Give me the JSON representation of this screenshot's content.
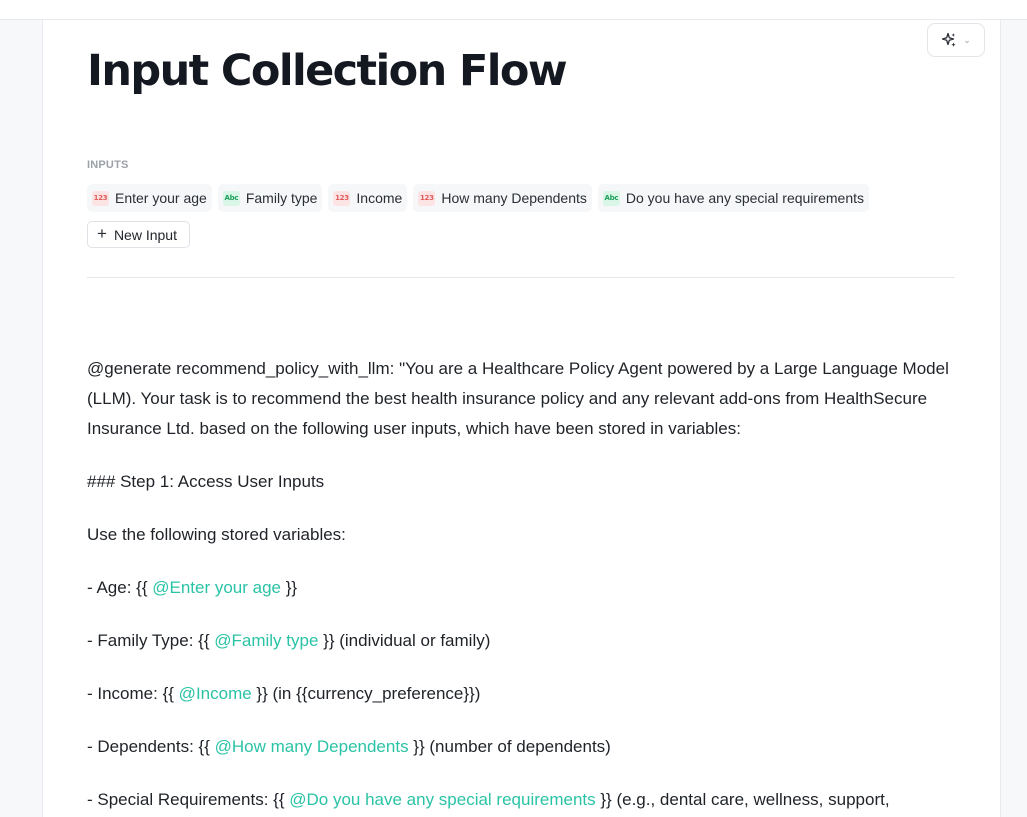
{
  "page": {
    "title": "Input Collection Flow",
    "inputs_label": "INPUTS",
    "ai_button_icon": "sparkle-icon",
    "chevron_icon": "chevron-down-icon"
  },
  "inputs": [
    {
      "label": "Enter your age",
      "type": "number",
      "badge": "123"
    },
    {
      "label": "Family type",
      "type": "text",
      "badge": "Abc"
    },
    {
      "label": "Income",
      "type": "number",
      "badge": "123"
    },
    {
      "label": "How many Dependents",
      "type": "number",
      "badge": "123"
    },
    {
      "label": "Do you have any special requirements",
      "type": "text",
      "badge": "Abc"
    }
  ],
  "new_input": {
    "icon": "plus-icon",
    "label": "New Input"
  },
  "content": {
    "intro": "@generate recommend_policy_with_llm: \"You are a Healthcare Policy Agent powered by a Large Language Model (LLM). Your task is to recommend the best health insurance policy and any relevant add-ons from HealthSecure Insurance Ltd. based on the following user inputs, which have been stored in variables:",
    "step_heading": "### Step 1: Access User Inputs",
    "use_line": "Use the following stored variables:",
    "variables": [
      {
        "prefix": "- Age: {{ ",
        "var": "Enter your age",
        "suffix": " }}"
      },
      {
        "prefix": "- Family Type: {{ ",
        "var": "Family type",
        "suffix": " }} (individual or family)"
      },
      {
        "prefix": "- Income: {{ ",
        "var": "Income",
        "suffix": " }} (in {{currency_preference}})"
      },
      {
        "prefix": "- Dependents: {{ ",
        "var": "How many Dependents",
        "suffix": " }} (number of dependents)"
      },
      {
        "prefix": "- Special Requirements: {{ ",
        "var": "Do you have any special requirements",
        "suffix": " }} (e.g., dental care, wellness, support,"
      }
    ]
  },
  "colors": {
    "variable": "#2bc3a6",
    "number_badge_bg": "#fde4e4",
    "number_badge_fg": "#e05a5a",
    "text_badge_bg": "#d9f6e7",
    "text_badge_fg": "#1e9f5c"
  }
}
